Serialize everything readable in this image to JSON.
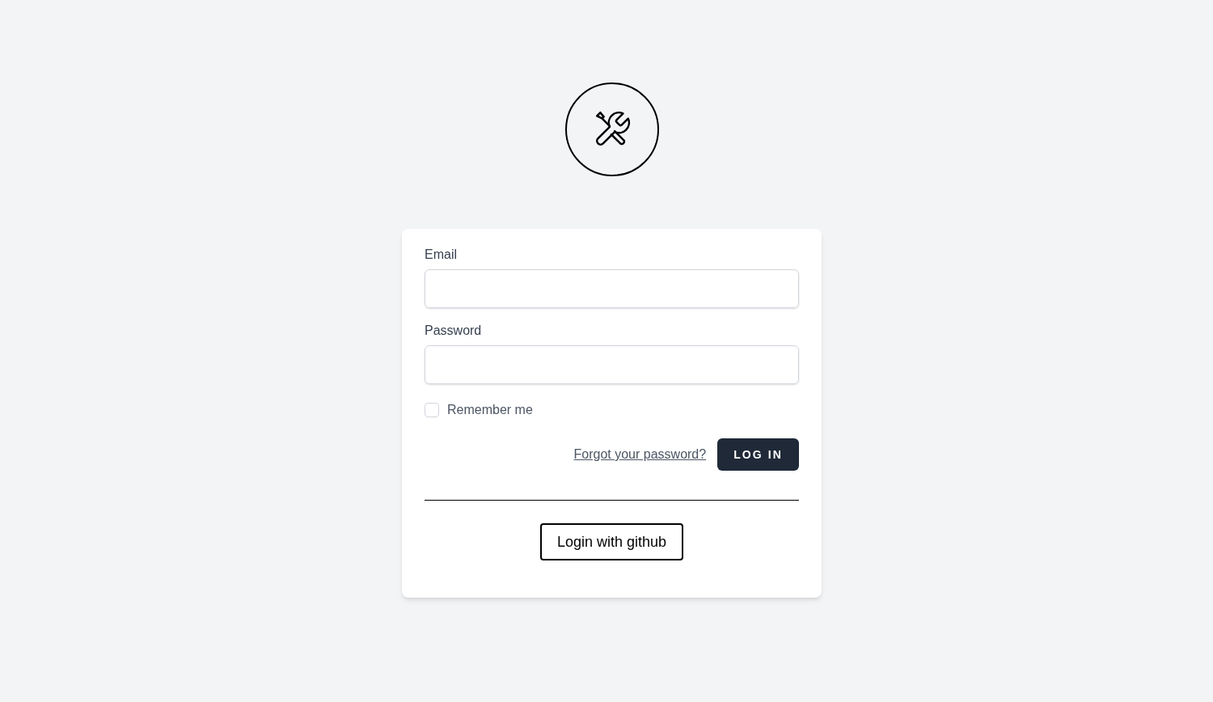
{
  "form": {
    "fields": [
      {
        "label": "Email"
      },
      {
        "label": "Password"
      }
    ],
    "remember": {
      "label": "Remember me",
      "checked": false
    },
    "forgot_link": "Forgot your password?",
    "login_button": "LOG IN",
    "github_button": "Login with github"
  }
}
